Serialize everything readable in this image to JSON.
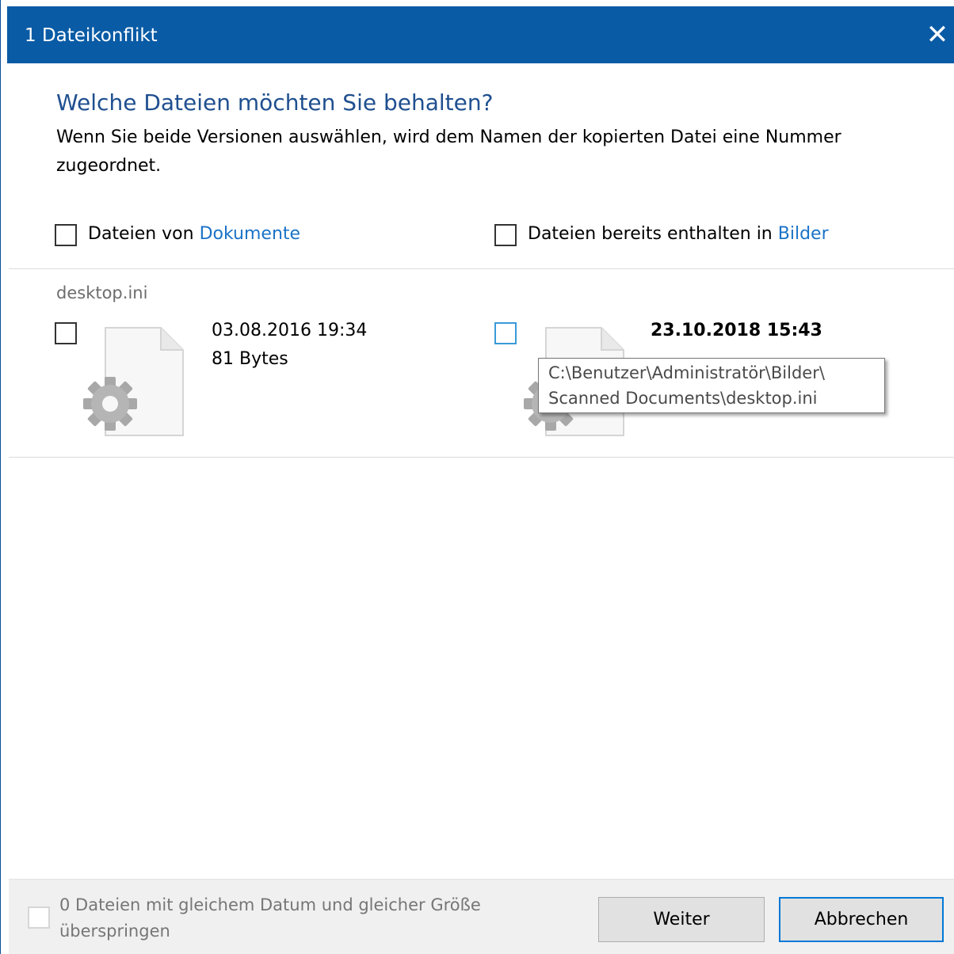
{
  "window": {
    "title": "1 Dateikonflikt",
    "close_glyph": "✕"
  },
  "dialog": {
    "heading": "Welche Dateien möchten Sie behalten?",
    "description": "Wenn Sie beide Versionen auswählen, wird dem Namen der kopierten Datei eine Nummer zugeordnet."
  },
  "select_all": {
    "source_prefix": "Dateien von",
    "source_link": "Dokumente",
    "dest_prefix": "Dateien bereits enthalten in",
    "dest_link": "Bilder"
  },
  "conflict": {
    "filename": "desktop.ini",
    "source": {
      "date": "03.08.2016 19:34",
      "size": "81 Bytes",
      "icon": "settings-file-icon"
    },
    "destination": {
      "date": "23.10.2018 15:43",
      "icon": "settings-file-icon"
    }
  },
  "tooltip": {
    "line1": "C:\\Benutzer\\Administratör\\Bilder\\",
    "line2": "Scanned Documents\\desktop.ini"
  },
  "footer": {
    "skip_label": "0 Dateien mit gleichem Datum und gleicher Größe überspringen",
    "continue_label": "Weiter",
    "cancel_label": "Abbrechen"
  },
  "colors": {
    "titlebar": "#0a5ba5",
    "heading": "#1f4f8f",
    "link": "#1a73c7",
    "default_button_border": "#0078d7"
  }
}
